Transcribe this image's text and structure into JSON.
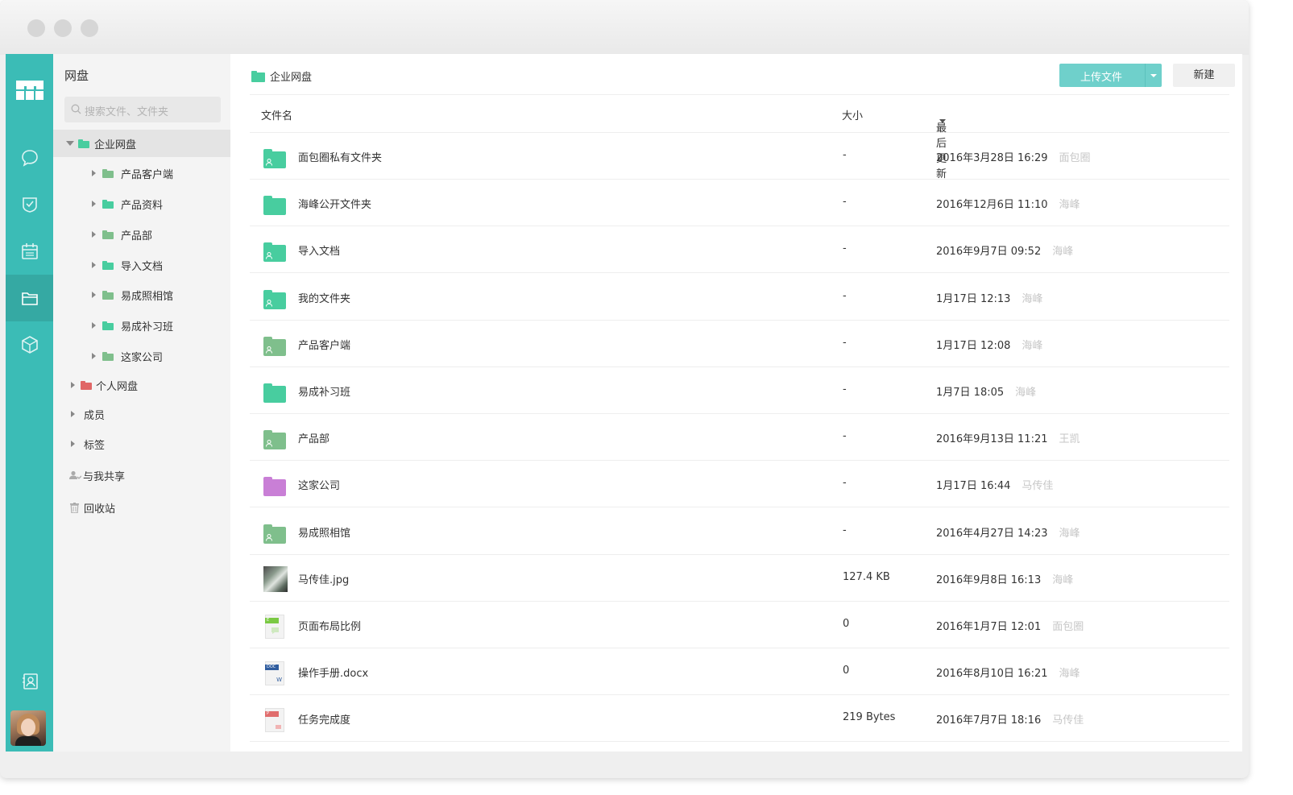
{
  "sidebar": {
    "title": "网盘",
    "search_placeholder": "搜索文件、文件夹",
    "enterprise": "企业网盘",
    "children": [
      "产品客户端",
      "产品资料",
      "产品部",
      "导入文档",
      "易成照相馆",
      "易成补习班",
      "这家公司"
    ],
    "personal": "个人网盘",
    "members": "成员",
    "tags": "标签",
    "shared": "与我共享",
    "recycle": "回收站"
  },
  "breadcrumb": "企业网盘",
  "toolbar": {
    "upload": "上传文件",
    "new": "新建"
  },
  "columns": {
    "name": "文件名",
    "size": "大小",
    "updated": "最后更新"
  },
  "files": [
    {
      "name": "面包圈私有文件夹",
      "size": "-",
      "time": "2016年3月28日 16:29",
      "user": "面包圈",
      "icon": "shared-folder-icon"
    },
    {
      "name": "海峰公开文件夹",
      "size": "-",
      "time": "2016年12月6日 11:10",
      "user": "海峰",
      "icon": "folder-icon"
    },
    {
      "name": "导入文档",
      "size": "-",
      "time": "2016年9月7日 09:52",
      "user": "海峰",
      "icon": "shared-folder-icon"
    },
    {
      "name": "我的文件夹",
      "size": "-",
      "time": "1月17日 12:13",
      "user": "海峰",
      "icon": "shared-folder-icon"
    },
    {
      "name": "产品客户端",
      "size": "-",
      "time": "1月17日 12:08",
      "user": "海峰",
      "icon": "shared-folder-icon"
    },
    {
      "name": "易成补习班",
      "size": "-",
      "time": "1月7日 18:05",
      "user": "海峰",
      "icon": "folder-icon"
    },
    {
      "name": "产品部",
      "size": "-",
      "time": "2016年9月13日 11:21",
      "user": "王凯",
      "icon": "shared-folder-icon"
    },
    {
      "name": "这家公司",
      "size": "-",
      "time": "1月17日 16:44",
      "user": "马传佳",
      "icon": "folder-icon"
    },
    {
      "name": "易成照相馆",
      "size": "-",
      "time": "2016年4月27日 14:23",
      "user": "海峰",
      "icon": "shared-folder-icon"
    },
    {
      "name": "马传佳.jpg",
      "size": "127.4 KB",
      "time": "2016年9月8日 16:13",
      "user": "海峰",
      "icon": "image-thumbnail-icon"
    },
    {
      "name": "页面布局比例",
      "size": "0",
      "time": "2016年1月7日 12:01",
      "user": "面包圈",
      "icon": "evernote-file-icon"
    },
    {
      "name": "操作手册.docx",
      "size": "0",
      "time": "2016年8月10日 16:21",
      "user": "海峰",
      "icon": "word-file-icon"
    },
    {
      "name": "任务完成度",
      "size": "219 Bytes",
      "time": "2016年7月7日 18:16",
      "user": "马传佳",
      "icon": "ppt-file-icon"
    }
  ],
  "colors": {
    "brand": "#3bbcb6",
    "folder_teal": "#48cd9f",
    "folder_sage": "#7fbf8c",
    "folder_purple": "#c97fd6",
    "folder_red": "#e06666"
  }
}
